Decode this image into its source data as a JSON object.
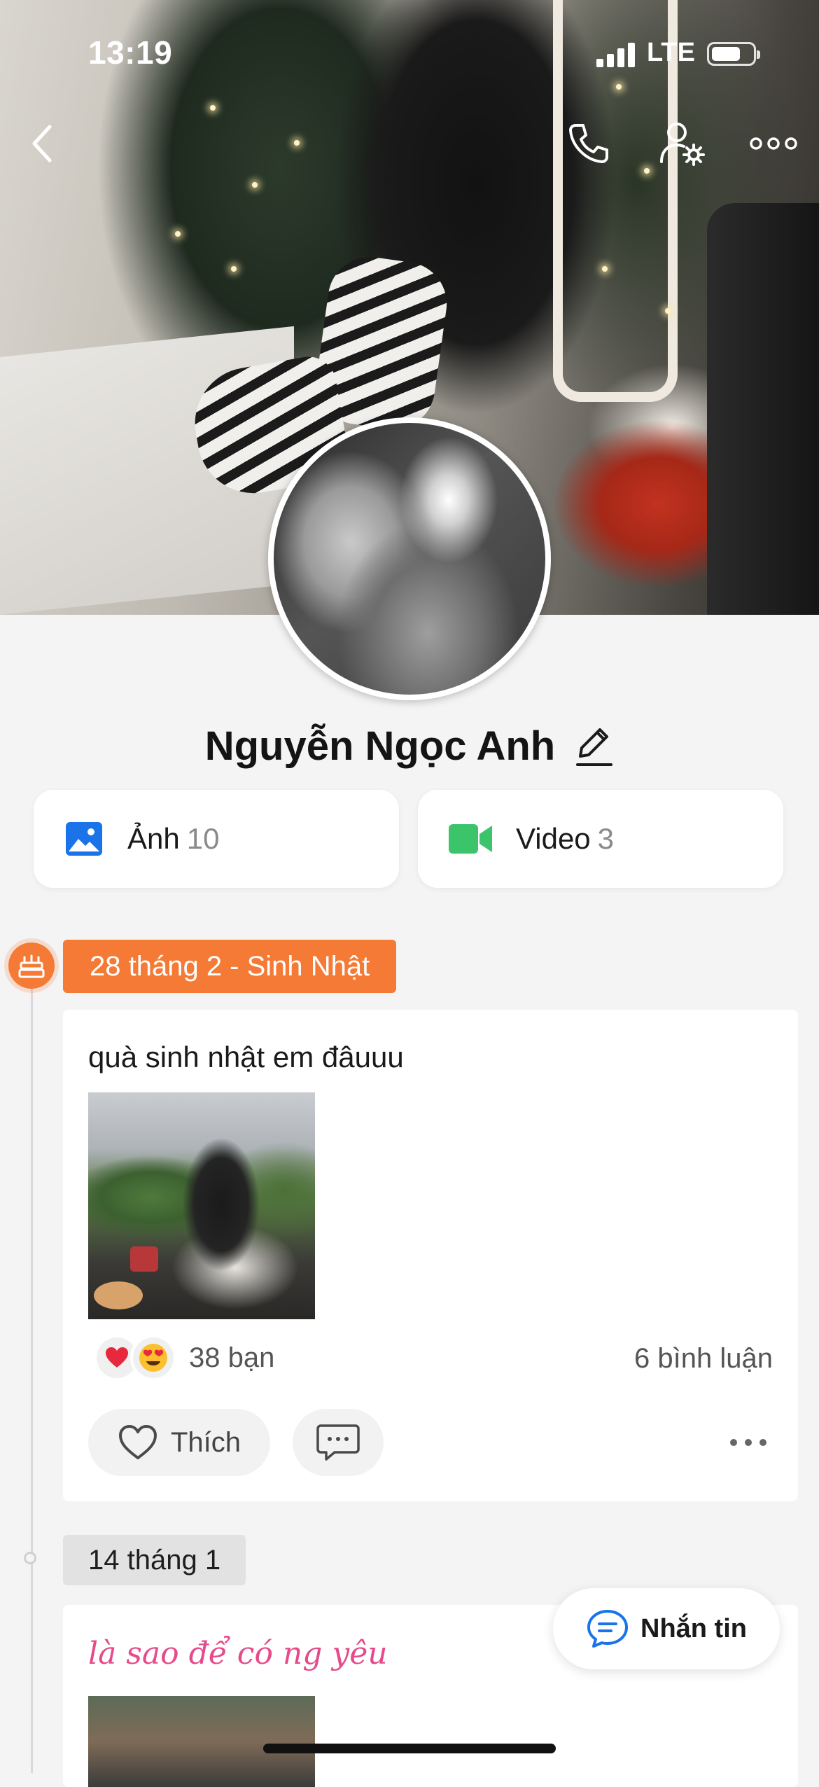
{
  "status_bar": {
    "time": "13:19",
    "network": "LTE"
  },
  "profile": {
    "name": "Nguyễn Ngọc Anh"
  },
  "media": {
    "photos": {
      "label": "Ảnh",
      "count": "10"
    },
    "videos": {
      "label": "Video",
      "count": "3"
    }
  },
  "timeline": {
    "birthday_tag": "28 tháng 2 - Sinh Nhật",
    "post1": {
      "text": "quà sinh nhật em đâuuu",
      "reactions": [
        "heart",
        "heart-eyes"
      ],
      "reaction_count": "38 bạn",
      "comments": "6 bình luận",
      "like_label": "Thích"
    },
    "date_tag": "14 tháng 1",
    "post2": {
      "text": "là sao để có ng yêu"
    }
  },
  "fab": {
    "label": "Nhắn tin"
  },
  "icons": {
    "back": "chevron-left-icon",
    "call": "phone-icon",
    "profile_settings": "user-gear-icon",
    "more": "ellipsis-icon",
    "edit": "pencil-icon",
    "photos": "image-icon",
    "videos": "video-camera-icon",
    "birthday": "cake-icon",
    "like": "heart-outline-icon",
    "comment": "chat-bubble-icon",
    "message": "chat-bubble-icon"
  },
  "colors": {
    "accent_orange": "#f47a35",
    "photo_blue": "#1a73e8",
    "video_green": "#3cc46b",
    "message_blue": "#1a73e8",
    "pink_text": "#e64a8a"
  }
}
